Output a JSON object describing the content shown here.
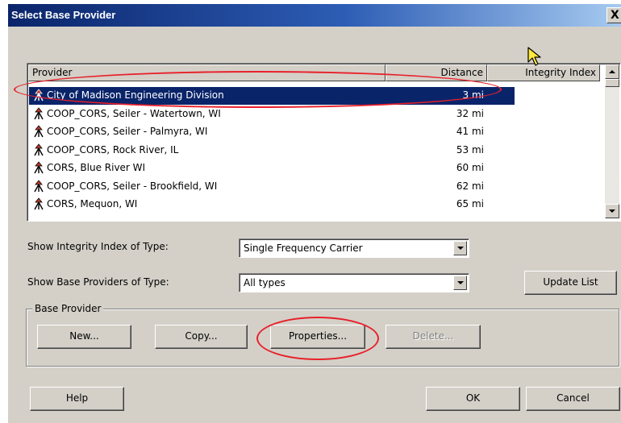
{
  "window": {
    "title": "Select Base Provider",
    "close_label": "X"
  },
  "list": {
    "columns": [
      "Provider",
      "Distance",
      "Integrity Index"
    ],
    "rows": [
      {
        "provider": "City of Madison Engineering Division",
        "distance": "3 mi",
        "selected": true
      },
      {
        "provider": "COOP_CORS, Seiler - Watertown, WI",
        "distance": "32 mi"
      },
      {
        "provider": "COOP_CORS, Seiler - Palmyra, WI",
        "distance": "41 mi"
      },
      {
        "provider": "COOP_CORS, Rock River, IL",
        "distance": "53 mi"
      },
      {
        "provider": "CORS, Blue River WI",
        "distance": "60 mi"
      },
      {
        "provider": "COOP_CORS, Seiler - Brookfield, WI",
        "distance": "62 mi"
      },
      {
        "provider": "CORS, Mequon, WI",
        "distance": "65 mi"
      }
    ],
    "row_icon": "survey-tripod-icon"
  },
  "filters": {
    "integrity_label": "Show Integrity Index of Type:",
    "integrity_value": "Single Frequency Carrier",
    "providers_label": "Show Base Providers of Type:",
    "providers_value": "All types",
    "update_button": "Update List"
  },
  "base_provider": {
    "group_label": "Base Provider",
    "new_button": "New...",
    "copy_button": "Copy...",
    "properties_button": "Properties...",
    "delete_button": "Delete..."
  },
  "footer": {
    "help_button": "Help",
    "ok_button": "OK",
    "cancel_button": "Cancel"
  },
  "colors": {
    "selection": "#0a246a",
    "annotation": "#e8202a",
    "dialog_bg": "#d4d0c8"
  }
}
